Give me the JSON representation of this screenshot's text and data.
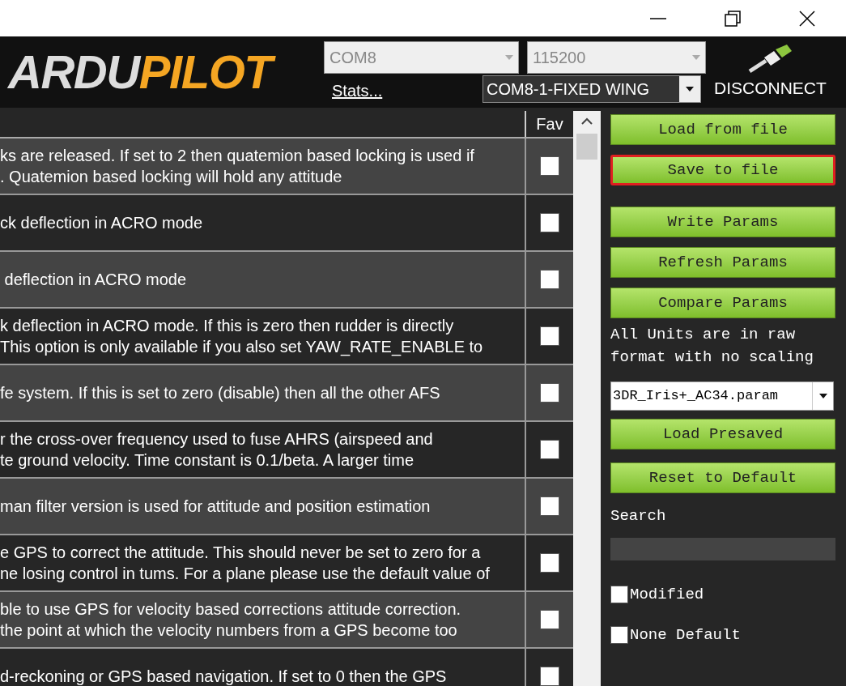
{
  "header": {
    "logo": {
      "part_1": "ARDU",
      "part_2": "PILOT"
    },
    "port": {
      "value": "COM8"
    },
    "baud": {
      "value": "115200"
    },
    "stats_link": "Stats...",
    "connection": {
      "value": "COM8-1-FIXED WING"
    },
    "disconnect": "DISCONNECT"
  },
  "table": {
    "columns": [
      "Fav"
    ],
    "rows": [
      {
        "description": [
          "ks are released. If set to 2 then quatemion based locking is used if",
          ". Quatemion based locking will hold any attitude"
        ],
        "fav": false
      },
      {
        "description": [
          "ck deflection in ACRO mode"
        ],
        "fav": false
      },
      {
        "description": [
          " deflection in ACRO mode"
        ],
        "fav": false
      },
      {
        "description": [
          "k deflection in ACRO mode. If this is zero then rudder is directly",
          "This option is only available if you also set YAW_RATE_ENABLE to"
        ],
        "fav": false
      },
      {
        "description": [
          "fe system. If this is set to zero (disable) then all the other AFS"
        ],
        "fav": false
      },
      {
        "description": [
          "r the cross-over frequency used to fuse AHRS (airspeed and",
          "te ground velocity. Time constant is 0.1/beta. A larger time"
        ],
        "fav": false
      },
      {
        "description": [
          "man filter version is used for attitude and position estimation"
        ],
        "fav": false
      },
      {
        "description": [
          "e GPS to correct the attitude. This should never be set to zero for a",
          "ne losing control in tums. For a plane please use the default value of"
        ],
        "fav": false
      },
      {
        "description": [
          "ble to use GPS for velocity based corrections attitude correction.",
          "the point at which the velocity numbers from a GPS become too"
        ],
        "fav": false
      },
      {
        "description": [
          "d-reckoning or GPS based navigation. If set to 0 then the GPS"
        ],
        "fav": false
      }
    ]
  },
  "sidebar": {
    "buttons_top": [
      {
        "label": "Load from file",
        "highlighted": false
      },
      {
        "label": "Save to file",
        "highlighted": true
      }
    ],
    "buttons_params": [
      {
        "label": "Write Params",
        "highlighted": false
      },
      {
        "label": "Refresh Params",
        "highlighted": false
      },
      {
        "label": "Compare Params",
        "highlighted": false
      }
    ],
    "note": "All Units are in raw format with no scaling",
    "param_file": {
      "value": "3DR_Iris+_AC34.param"
    },
    "buttons_bottom": [
      {
        "label": "Load Presaved",
        "highlighted": false
      },
      {
        "label": "Reset to Default",
        "highlighted": false
      }
    ],
    "search_label": "Search",
    "checkboxes": [
      {
        "label": "Modified",
        "checked": false
      },
      {
        "label": "None Default",
        "checked": false
      }
    ]
  }
}
